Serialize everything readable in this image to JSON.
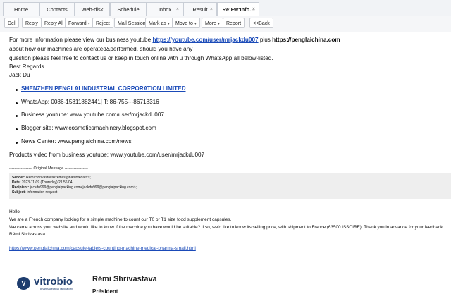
{
  "tabs": [
    {
      "label": "Home",
      "closable": false
    },
    {
      "label": "Contacts",
      "closable": false
    },
    {
      "label": "Web-disk",
      "closable": false
    },
    {
      "label": "Schedule",
      "closable": false
    },
    {
      "label": "Inbox",
      "closable": true
    },
    {
      "label": "Result",
      "closable": true
    },
    {
      "label": "Re:Fw:Info...",
      "closable": true,
      "active": true
    }
  ],
  "toolbar": {
    "del": "Del",
    "reply": "Reply",
    "reply_all": "Reply All",
    "forward": "Forward",
    "reject": "Reject",
    "mail_session": "Mail Session",
    "mark_as": "Mark as",
    "move_to": "Move to",
    "more": "More",
    "report": "Report",
    "back": "<<Back"
  },
  "close_glyph": "×",
  "dropdown_glyph": "▾",
  "body": {
    "line1_a": "For more information please view our business youtube ",
    "line1_link": "https://youtube.com/user/mrjackdu007",
    "line1_b": " plus ",
    "line1_site": "https://penglaichina.com",
    "line2": "about how our machines are operated&performed. should you have any",
    "line3": "question please feel free to contact us or keep in touch online with u through WhatsApp,all below-listed.",
    "regards": "Best Regards",
    "name": "Jack Du",
    "company": "SHENZHEN PENGLAI INDUSTRIAL CORPORATION LIMITED",
    "whatsapp": "WhatsApp: 0086-15811882441| T: 86-755---86718316",
    "youtube": "Business youtube:  www.youtube.com/user/mrjackdu007",
    "blogger": "Blogger site:          www.cosmeticsmachinery.blogspot.com",
    "news": "News Center:       www.penglaichina.com/news",
    "products": "Products video from business youtube: www.youtube.com/user/mrjackdu007"
  },
  "original": {
    "divider": "------------------ Original Message ------------------",
    "sender_label": "Sender:",
    "sender": "Rémi Shrivastava<remi.s@naturveda.fr>;",
    "date_label": "Date:",
    "date": "2023-11-09 (Thursday) 21:56:04",
    "recipient_label": "Recipient:",
    "recipient": "jackdu999@penglaipacking.com<jackdu999@penglaipacking.com>;",
    "subject_label": "Subject:",
    "subject": "Information request",
    "hello": "Hello,",
    "p1": "We are a French company looking for a simple machine to count our T0 or T1 size food supplement capsules.",
    "p2": "We came across your website and would like to know if the machine you have would be suitable? If so, we'd like to know its selling price, with shipment to France (63500 ISSOIRE). Thank you in advance for your feedback.",
    "sign": "Rémi Shrivastava",
    "url": "https://www.penglaichina.com/capsule-tablets-counting-machine-medical-pharma-small.html"
  },
  "signature": {
    "logo_mark": "V",
    "logo_text": "vitrobio",
    "logo_sub": "pharmaceutical laboratory",
    "name": "Rémi Shrivastava",
    "role": "Président"
  }
}
